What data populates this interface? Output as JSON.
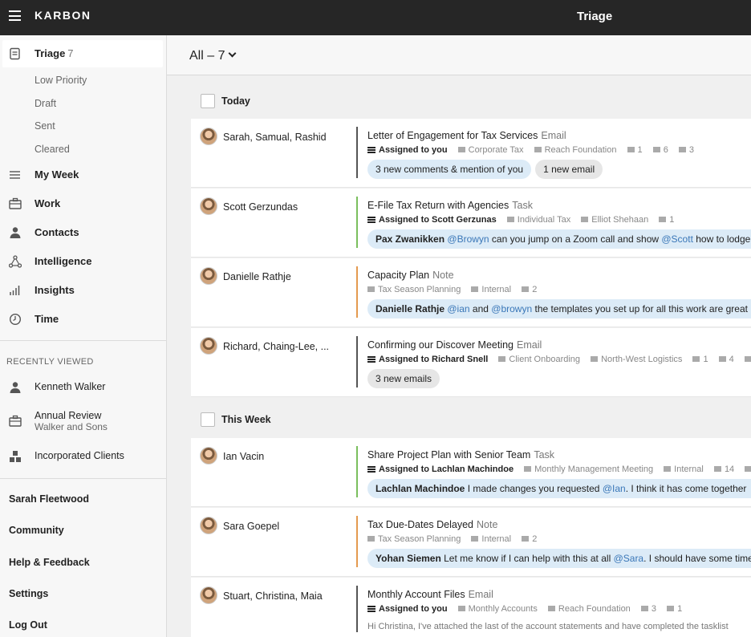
{
  "app": {
    "brand": "KARBON",
    "title": "Triage"
  },
  "sidebar": {
    "triage": {
      "label": "Triage",
      "count": "7"
    },
    "sub_items": [
      "Low Priority",
      "Draft",
      "Sent",
      "Cleared"
    ],
    "nav": [
      {
        "label": "My Week",
        "icon": "my-week-icon"
      },
      {
        "label": "Work",
        "icon": "briefcase-icon"
      },
      {
        "label": "Contacts",
        "icon": "person-icon"
      },
      {
        "label": "Intelligence",
        "icon": "network-icon"
      },
      {
        "label": "Insights",
        "icon": "bar-chart-icon"
      },
      {
        "label": "Time",
        "icon": "clock-icon"
      }
    ],
    "recently_viewed": {
      "heading": "RECENTLY VIEWED",
      "items": [
        {
          "label": "Kenneth Walker",
          "sub": "",
          "icon": "person-icon"
        },
        {
          "label": "Annual Review",
          "sub": "Walker and Sons",
          "icon": "briefcase-icon"
        },
        {
          "label": "Incorporated Clients",
          "sub": "",
          "icon": "group-icon"
        }
      ]
    },
    "bottom": [
      "Sarah Fleetwood",
      "Community",
      "Help & Feedback",
      "Settings",
      "Log Out"
    ]
  },
  "filter": {
    "label": "All – 7"
  },
  "groups": [
    {
      "title": "Today"
    },
    {
      "title": "This Week"
    }
  ],
  "rows": [
    {
      "who": "Sarah, Samual, Rashid",
      "title": "Letter of Engagement for Tax Services",
      "type": "Email",
      "assigned": "Assigned to you",
      "meta": [
        "Corporate Tax",
        "Reach Foundation",
        "1",
        "6",
        "3"
      ],
      "pills": [
        "3 new comments & mention of you",
        "1 new email"
      ]
    },
    {
      "who": "Scott Gerzundas",
      "title": "E-File Tax Return with Agencies",
      "type": "Task",
      "assigned": "Assigned to Scott Gerzunas",
      "meta": [
        "Individual Tax",
        "Elliot Shehaan",
        "1"
      ],
      "snippet": {
        "author": "Pax Zwanikken",
        "mention1": "@Browyn",
        "text1": " can you jump on a Zoom call and show ",
        "mention2": "@Scott",
        "text2": " how to lodge"
      }
    },
    {
      "who": "Danielle Rathje",
      "title": "Capacity Plan",
      "type": "Note",
      "meta": [
        "Tax Season Planning",
        "Internal",
        "2"
      ],
      "snippet": {
        "author": "Danielle Rathje",
        "mention1": "@ian",
        "text1": " and ",
        "mention2": "@browyn",
        "text2": " the templates you set up for all this work are great"
      }
    },
    {
      "who": "Richard, Chaing-Lee, ...",
      "title": "Confirming our Discover Meeting",
      "type": "Email",
      "assigned": "Assigned to Richard Snell",
      "meta": [
        "Client Onboarding",
        "North-West Logistics",
        "1",
        "4",
        "4"
      ],
      "pills": [
        "3 new emails"
      ]
    },
    {
      "who": "Ian Vacin",
      "title": "Share Project Plan with Senior Team",
      "type": "Task",
      "assigned": "Assigned to Lachlan Machindoe",
      "meta": [
        "Monthly Management Meeting",
        "Internal",
        "14",
        "2"
      ],
      "snippet": {
        "author": "Lachlan Machindoe",
        "text0": " I made changes you requested ",
        "mention1": "@Ian",
        "text1": ". I think it has come together"
      }
    },
    {
      "who": "Sara Goepel",
      "title": "Tax Due-Dates Delayed",
      "type": "Note",
      "meta": [
        "Tax Season Planning",
        "Internal",
        "2"
      ],
      "snippet": {
        "author": "Yohan Siemen",
        "text0": " Let me know if I can help with this at all ",
        "mention1": "@Sara",
        "text1": ". I should have some time"
      }
    },
    {
      "who": "Stuart, Christina, Maia",
      "title": "Monthly Account Files",
      "type": "Email",
      "assigned": "Assigned to you",
      "meta": [
        "Monthly Accounts",
        "Reach Foundation",
        "3",
        "1"
      ],
      "plain": "Hi Christina, I've attached the last of the account statements and have completed the tasklist"
    }
  ]
}
